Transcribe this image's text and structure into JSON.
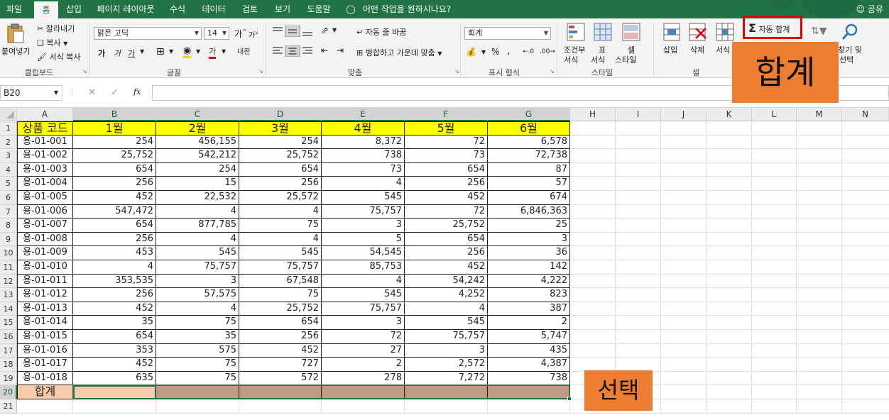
{
  "tabs": [
    "파일",
    "홈",
    "삽입",
    "페이지 레이아웃",
    "수식",
    "데이터",
    "검토",
    "보기",
    "도움말"
  ],
  "tell_me": "어떤 작업을 원하시나요?",
  "share": "공유",
  "ribbon": {
    "clipboard": {
      "paste": "붙여넣기",
      "cut": "잘라내기",
      "copy": "복사",
      "format_painter": "서식 복사",
      "label": "클립보드"
    },
    "font": {
      "name": "맑은 고딕",
      "size": "14",
      "bold": "가",
      "italic": "가",
      "underline": "가",
      "font_color_glyph": "가",
      "phonetic": "내천",
      "grow": "가",
      "shrink": "가",
      "label": "글꼴"
    },
    "alignment": {
      "wrap": "자동 줄 바꿈",
      "merge": "병합하고 가운데 맞춤",
      "label": "맞춤"
    },
    "number": {
      "format": "회계",
      "percent": "%",
      "comma": ",",
      "label": "표시 형식"
    },
    "styles": {
      "conditional": "조건부",
      "conditional2": "서식",
      "table": "표",
      "table2": "서식",
      "cell": "셀",
      "cell2": "스타일",
      "label": "스타일"
    },
    "cells": {
      "insert": "삽입",
      "delete": "삭제",
      "format": "서식",
      "label": "셀"
    },
    "editing": {
      "autosum": "자동 합계",
      "find": "찾기 및",
      "find2": "선택"
    }
  },
  "callouts": {
    "autosum": "합계",
    "select": "선택"
  },
  "formula_bar": {
    "name_box": "B20",
    "fx": "fx"
  },
  "columns": [
    "A",
    "B",
    "C",
    "D",
    "E",
    "F",
    "G",
    "H",
    "I",
    "J",
    "K",
    "L",
    "M",
    "N"
  ],
  "rows": [
    "1",
    "2",
    "3",
    "4",
    "5",
    "6",
    "7",
    "8",
    "9",
    "10",
    "11",
    "12",
    "13",
    "14",
    "15",
    "16",
    "17",
    "18",
    "19",
    "20",
    "21"
  ],
  "table": {
    "headers": [
      "상품 코드",
      "1월",
      "2월",
      "3월",
      "4월",
      "5월",
      "6월"
    ],
    "rows": [
      [
        "용-01-001",
        "254",
        "456,155",
        "254",
        "8,372",
        "72",
        "6,578"
      ],
      [
        "용-01-002",
        "25,752",
        "542,212",
        "25,752",
        "738",
        "73",
        "72,738"
      ],
      [
        "용-01-003",
        "654",
        "254",
        "654",
        "73",
        "654",
        "87"
      ],
      [
        "용-01-004",
        "256",
        "15",
        "256",
        "4",
        "256",
        "57"
      ],
      [
        "용-01-005",
        "452",
        "22,532",
        "25,572",
        "545",
        "452",
        "674"
      ],
      [
        "용-01-006",
        "547,472",
        "4",
        "4",
        "75,757",
        "72",
        "6,846,363"
      ],
      [
        "용-01-007",
        "654",
        "877,785",
        "75",
        "3",
        "25,752",
        "25"
      ],
      [
        "용-01-008",
        "256",
        "4",
        "4",
        "5",
        "654",
        "3"
      ],
      [
        "용-01-009",
        "453",
        "545",
        "545",
        "54,545",
        "256",
        "36"
      ],
      [
        "용-01-010",
        "4",
        "75,757",
        "75,757",
        "85,753",
        "452",
        "142"
      ],
      [
        "용-01-011",
        "353,535",
        "3",
        "67,548",
        "4",
        "54,242",
        "4,222"
      ],
      [
        "용-01-012",
        "256",
        "57,575",
        "75",
        "545",
        "4,252",
        "823"
      ],
      [
        "용-01-013",
        "452",
        "4",
        "25,752",
        "75,757",
        "4",
        "387"
      ],
      [
        "용-01-014",
        "35",
        "75",
        "654",
        "3",
        "545",
        "2"
      ],
      [
        "용-01-015",
        "654",
        "35",
        "256",
        "72",
        "75,757",
        "5,747"
      ],
      [
        "용-01-016",
        "353",
        "575",
        "452",
        "27",
        "3",
        "435"
      ],
      [
        "용-01-017",
        "452",
        "75",
        "727",
        "2",
        "2,572",
        "4,387"
      ],
      [
        "용-01-018",
        "635",
        "75",
        "572",
        "278",
        "7,272",
        "738"
      ]
    ],
    "total_label": "합계"
  },
  "colors": {
    "ribbon_green": "#217346",
    "header_yellow": "#ffff00",
    "total_peach": "#f8cbad",
    "selection_brown": "#c19a85",
    "callout_orange": "#ed7d31",
    "highlight_red": "#e00000"
  }
}
